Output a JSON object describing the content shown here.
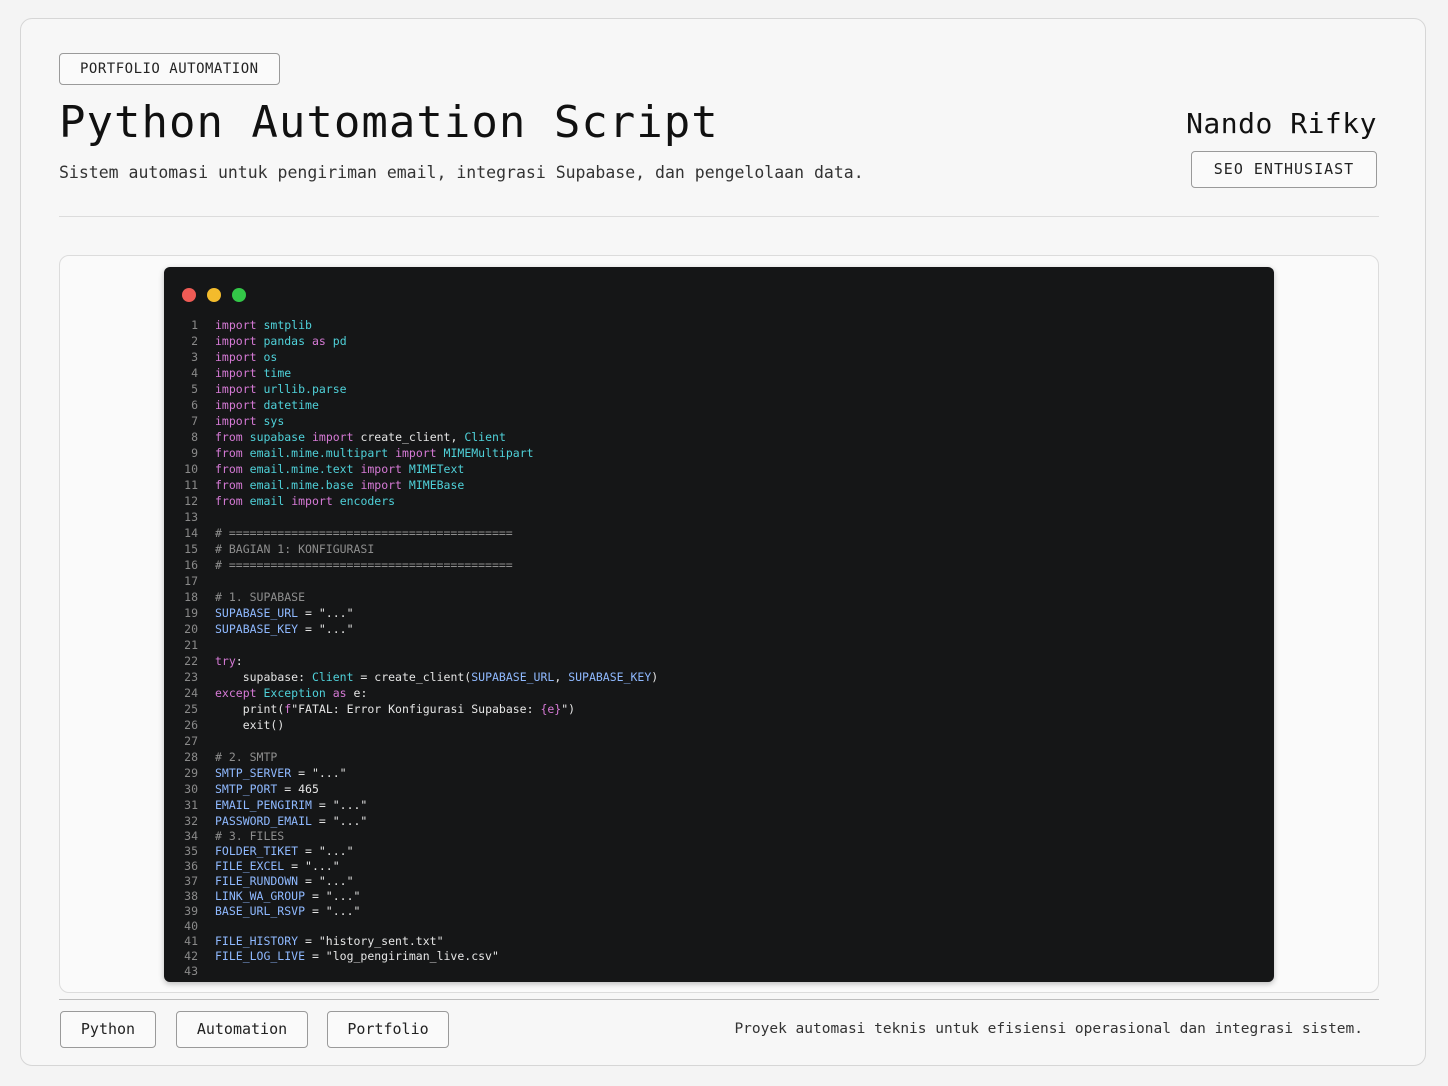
{
  "header": {
    "badge": "PORTFOLIO AUTOMATION",
    "title": "Python Automation Script",
    "subtitle": "Sistem automasi untuk pengiriman email, integrasi Supabase, dan pengelolaan data.",
    "author_name": "Nando Rifky",
    "author_role": "SEO ENTHUSIAST"
  },
  "code": {
    "window_dots": [
      "red",
      "yellow",
      "green"
    ],
    "lines": [
      "1",
      "2",
      "3",
      "4",
      "5",
      "6",
      "7",
      "8",
      "9",
      "10",
      "11",
      "12",
      "13",
      "14",
      "15",
      "16",
      "17",
      "18",
      "19",
      "20",
      "21",
      "22",
      "23",
      "24",
      "25",
      "26",
      "27",
      "28",
      "29",
      "30",
      "31",
      "32",
      "34",
      "35",
      "36",
      "37",
      "38",
      "39",
      "40",
      "41",
      "42",
      "43"
    ]
  },
  "tags": [
    "Python",
    "Automation",
    "Portfolio"
  ],
  "footer": {
    "note": "Proyek automasi teknis untuk efisiensi operasional dan integrasi sistem."
  },
  "colors": {
    "terminal_bg": "#151617",
    "keyword": "#d67ad6",
    "module": "#4fd1d9",
    "variable": "#8fb9ff",
    "comment": "#8e8e8e"
  }
}
